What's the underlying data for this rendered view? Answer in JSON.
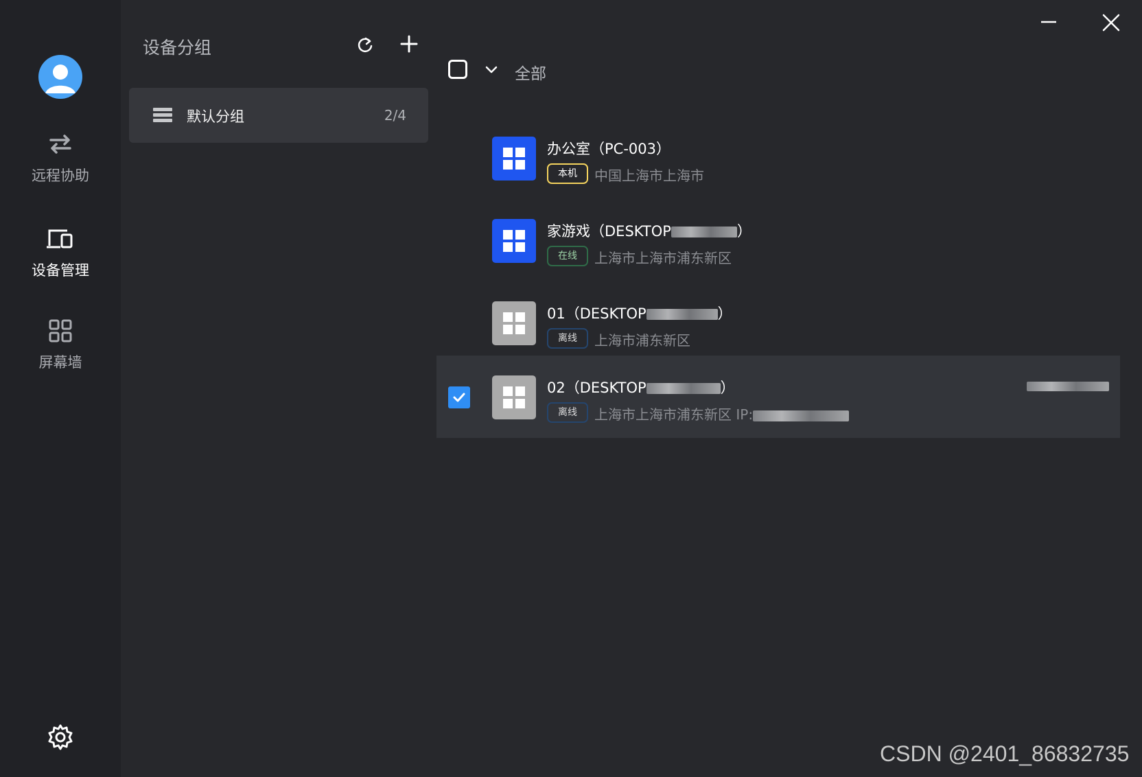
{
  "sidebar": {
    "items": [
      {
        "label": "远程协助",
        "icon": "arrows-swap-icon"
      },
      {
        "label": "设备管理",
        "icon": "device-monitor-icon"
      },
      {
        "label": "屏幕墙",
        "icon": "grid-icon"
      }
    ],
    "settings_icon": "gear-icon"
  },
  "groups": {
    "title": "设备分组",
    "items": [
      {
        "name": "默认分组",
        "count": "2/4"
      }
    ]
  },
  "list": {
    "filter_label": "全部",
    "devices": [
      {
        "name": "办公室（PC-003）",
        "badge": "本机",
        "location": "中国上海市上海市",
        "status": "local",
        "selected": false
      },
      {
        "name_prefix": "家游戏（DESKTOP",
        "name_suffix": "）",
        "badge": "在线",
        "location": "上海市上海市浦东新区",
        "status": "online",
        "selected": false
      },
      {
        "name_prefix": "01（DESKTOP",
        "name_suffix": "）",
        "badge": "离线",
        "location": "上海市浦东新区",
        "status": "offline",
        "selected": false
      },
      {
        "name_prefix": "02（DESKTOP",
        "name_suffix": "）",
        "badge": "离线",
        "location": "上海市上海市浦东新区 IP:",
        "status": "offline",
        "selected": true
      }
    ]
  },
  "watermark": "CSDN @2401_86832735",
  "colors": {
    "accent": "#2f8ef5",
    "windows_blue": "#1f56f0",
    "offline_grey": "#aaaaaa",
    "online_green": "#2f6b48",
    "local_yellow": "#f4d35e"
  }
}
